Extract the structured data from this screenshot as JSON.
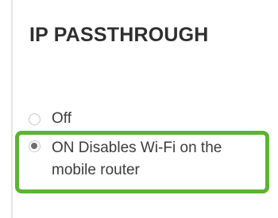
{
  "section": {
    "title": "IP PASSTHROUGH"
  },
  "options": {
    "off": {
      "label": "Off",
      "selected": false
    },
    "on": {
      "label": "ON Disables Wi-Fi on the mobile router",
      "selected": true
    }
  },
  "colors": {
    "highlight": "#5cb335",
    "radio_dot": "#6e6e6e",
    "text": "#3c3c3c"
  }
}
